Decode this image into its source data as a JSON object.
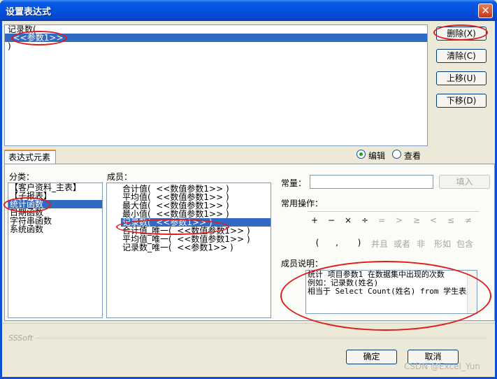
{
  "window": {
    "title": "设置表达式",
    "close_glyph": "✕"
  },
  "expression": {
    "lines": [
      "记录数(",
      "  <<参数1>>",
      ")"
    ],
    "selected_index": 1
  },
  "side_buttons": {
    "delete": "删除(X)",
    "clear": "清除(C)",
    "move_up": "上移(U)",
    "move_down": "下移(D)"
  },
  "tab": {
    "label": "表达式元素"
  },
  "mode": {
    "edit": "编辑",
    "view": "查看",
    "selected": "edit"
  },
  "category": {
    "label": "分类：",
    "items": [
      "【客户资料_主表】",
      "【子报表】",
      "统计函数",
      "日期函数",
      "字符串函数",
      "系统函数"
    ],
    "selected_index": 2
  },
  "members": {
    "label": "成员：",
    "items": [
      "合计值(  <<数值参数1>> )",
      "平均值(  <<数值参数1>> )",
      "最大值(  <<数值参数1>> )",
      "最小值(  <<数值参数1>> )",
      "记录数(  <<参数1>> )",
      "合计值_唯一(  <<数值参数1>> )",
      "平均值_唯一(  <<数值参数1>> )",
      "记录数_唯一(  <<参数1>> )"
    ],
    "selected_index": 4
  },
  "constant": {
    "label": "常量：",
    "value": "",
    "fill_button": "填入"
  },
  "operators": {
    "label": "常用操作：",
    "row1": [
      "+",
      "−",
      "×",
      "÷",
      "=",
      ">",
      "≥",
      "<",
      "≤",
      "≠"
    ],
    "row2": [
      "(",
      ",",
      ")",
      "并且",
      "或者",
      "非",
      "形如",
      "包含"
    ]
  },
  "member_desc": {
    "label": "成员说明：",
    "lines": [
      "统计 项目参数1 在数据集中出现的次数",
      "例如：记录数(姓名)",
      "相当于 Select Count(姓名) from 学生表"
    ]
  },
  "footer": {
    "brand": "SSSoft",
    "ok": "确定",
    "cancel": "取消",
    "watermark": "CSDN @Excel_Yun"
  },
  "colors": {
    "selection": "#316ac5",
    "annotation": "#e01b1b"
  }
}
